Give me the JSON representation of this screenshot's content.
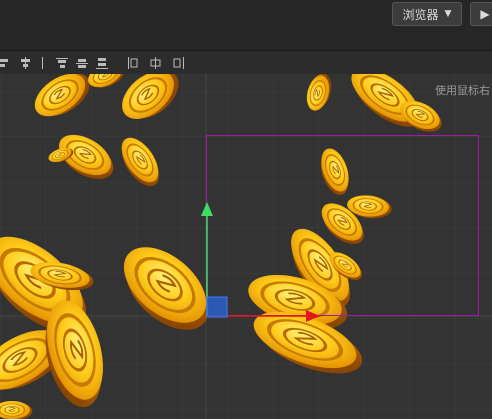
{
  "header": {
    "browser_label": "浏览器",
    "browser_caret": "▼",
    "play_icon": "play-icon"
  },
  "toolbar": {
    "align_icons": [
      "align-left-icon",
      "align-center-h-icon",
      "align-right-icon",
      "align-top-icon",
      "align-middle-v-icon",
      "align-bottom-icon",
      "distribute-h-icon",
      "distribute-v-icon",
      "distribute-center-icon"
    ]
  },
  "scene": {
    "hint_text": "使用鼠标右",
    "colors": {
      "background": "#333333",
      "grid": "#3d3d3d",
      "selection_rect": "#9b1fa3",
      "gizmo_y": "#3ddc62",
      "gizmo_x": "#e0191e",
      "gizmo_center": "#2a60c9",
      "coin": "#ffb300"
    }
  }
}
